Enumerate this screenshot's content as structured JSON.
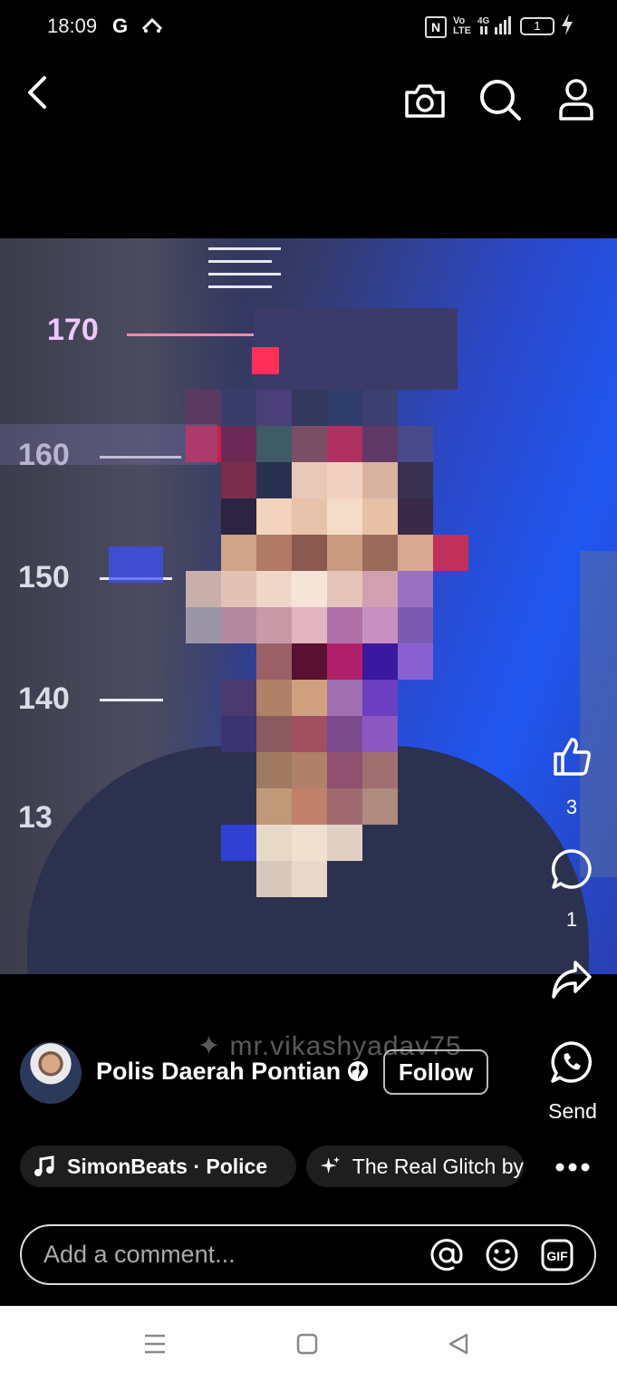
{
  "status_bar": {
    "time": "18:09",
    "g_label": "G",
    "volte": "Vo\nLTE",
    "signal": "4G",
    "battery": "1"
  },
  "top_nav": {
    "icons": [
      "back-icon",
      "camera-icon",
      "search-icon",
      "profile-icon"
    ]
  },
  "video": {
    "scale_marks": [
      "170",
      "160",
      "150",
      "140",
      "13"
    ]
  },
  "actions": {
    "like_count": "3",
    "comment_count": "1",
    "send_label": "Send"
  },
  "poster": {
    "watermark": "mr.vikashyadav75",
    "name": "Polis Daerah Pontian",
    "follow_label": "Follow"
  },
  "chips": {
    "music": "SimonBeats · Police",
    "effect": "The Real Glitch by"
  },
  "comment": {
    "placeholder": "Add a comment..."
  },
  "colors": {
    "background": "#000000",
    "navbar": "#ffffff",
    "chip_bg": "#1e1e1e"
  }
}
